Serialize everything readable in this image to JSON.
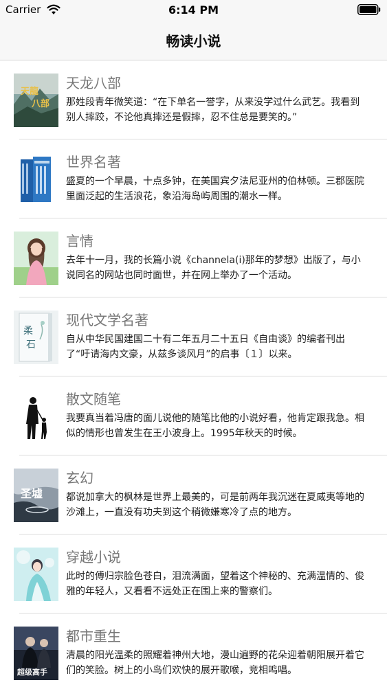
{
  "status_bar": {
    "carrier": "Carrier",
    "time": "6:14 PM"
  },
  "nav": {
    "title": "畅读小说"
  },
  "books": [
    {
      "name": "天龙八部",
      "cover_icon": "wuxia-book-cover",
      "desc": "那姓段青年微笑道：“在下单名一誉字，从来没学过什么武艺。我看到别人摔跤，不论他真摔还是假摔，忍不住总是要笑的。”"
    },
    {
      "name": "世界名著",
      "cover_icon": "classics-book-cover",
      "desc": "盛夏的一个早晨，十点多钟，在美国宾夕法尼亚州的伯林顿。三郡医院里面泛起的生活浪花，象沿海岛屿周围的潮水一样。"
    },
    {
      "name": "言情",
      "cover_icon": "romance-book-cover",
      "desc": "去年十一月，我的长篇小说《channela(i)那年的梦想》出版了，与小说同名的网站也同时面世，并在网上举办了一个活动。"
    },
    {
      "name": "现代文学名著",
      "cover_icon": "modern-literature-book-cover",
      "desc": "自从中华民国建国二十有二年五月二十五日《自由谈》的编者刊出了“吁请海内文豪，从兹多谈风月”的启事〔１〕以来。"
    },
    {
      "name": "散文随笔",
      "cover_icon": "essay-book-cover",
      "desc": "我要真当着冯唐的面儿说他的随笔比他的小说好看，他肯定跟我急。相似的情形也曾发生在王小波身上。1995年秋天的时候。"
    },
    {
      "name": "玄幻",
      "cover_icon": "fantasy-book-cover",
      "desc": "都说加拿大的枫林是世界上最美的，可是前两年我沉迷在夏威夷等地的沙滩上，一直没有功夫到这个稍微嫌寒冷了点的地方。"
    },
    {
      "name": "穿越小说",
      "cover_icon": "time-travel-book-cover",
      "desc": "此时的傅归宗脸色苍白，泪流满面，望着这个神秘的、充满温情的、俊雅的年轻人，又看看不远处正在围上来的警察们。"
    },
    {
      "name": "都市重生",
      "cover_icon": "urban-rebirth-book-cover",
      "desc": "清晨的阳光温柔的照耀着神州大地，漫山遍野的花朵迎着朝阳展开着它们的笑脸。树上的小鸟们欢快的展开歌喉，竞相鸣唱。"
    }
  ]
}
